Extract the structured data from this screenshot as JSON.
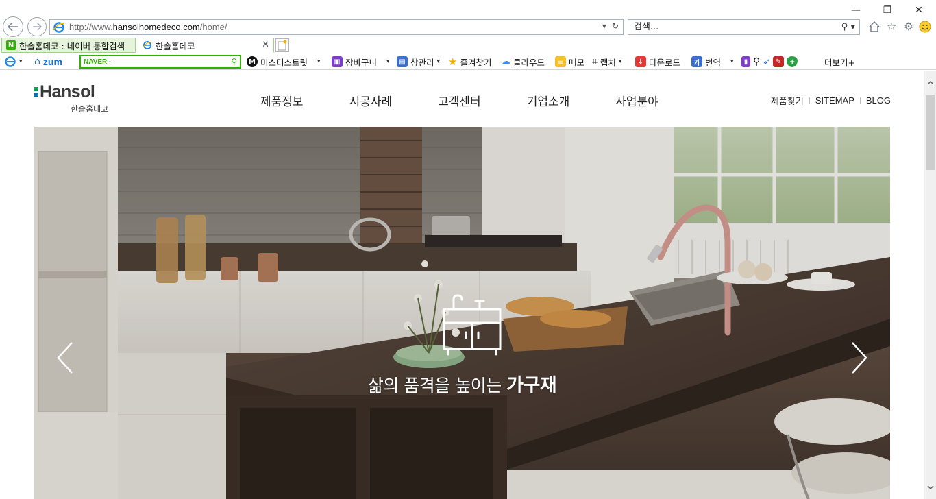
{
  "browser": {
    "window_controls": {
      "minimize": "—",
      "restore": "❐",
      "close": "✕"
    },
    "address": {
      "url_prefix": "http://www.",
      "url_domain": "hansolhomedeco.com",
      "url_suffix": "/home/"
    },
    "search": {
      "placeholder": "검색..."
    },
    "tabs": [
      {
        "label": "한솔홈데코 : 네이버 통합검색",
        "favicon": "N",
        "active": false
      },
      {
        "label": "한솔홈데코",
        "favicon": "e",
        "active": true
      }
    ],
    "toolbar": {
      "zum": "zum",
      "naver_label": "NAVER ·",
      "items": [
        {
          "label": "미스터스트릿",
          "icon": "M"
        },
        {
          "label": "장바구니",
          "icon": "cart-icon"
        },
        {
          "label": "창관리",
          "icon": "window-icon"
        },
        {
          "label": "즐겨찾기",
          "icon": "star-icon"
        },
        {
          "label": "클라우드",
          "icon": "cloud-icon"
        },
        {
          "label": "메모",
          "icon": "memo-icon"
        },
        {
          "label": "캡처",
          "icon": "crop-icon"
        },
        {
          "label": "다운로드",
          "icon": "download-icon"
        },
        {
          "label": "번역",
          "icon": "translate-icon"
        },
        {
          "label": "더보기+",
          "icon": "more-icon"
        }
      ]
    }
  },
  "site": {
    "logo": {
      "word": "Hansol",
      "sub": "한솔홈데코"
    },
    "nav": [
      "제품정보",
      "시공사례",
      "고객센터",
      "기업소개",
      "사업분야"
    ],
    "util_links": [
      "제품찾기",
      "SITEMAP",
      "BLOG"
    ],
    "hero": {
      "caption_prefix": "삶의 품격을 높이는 ",
      "caption_highlight": "가구재",
      "prev_arrow": "‹",
      "next_arrow": "›"
    }
  },
  "colors": {
    "brand_green": "#2db400",
    "logo_green": "#00a651",
    "logo_blue": "#0072bc",
    "tab_bg": "#e5f4da"
  }
}
